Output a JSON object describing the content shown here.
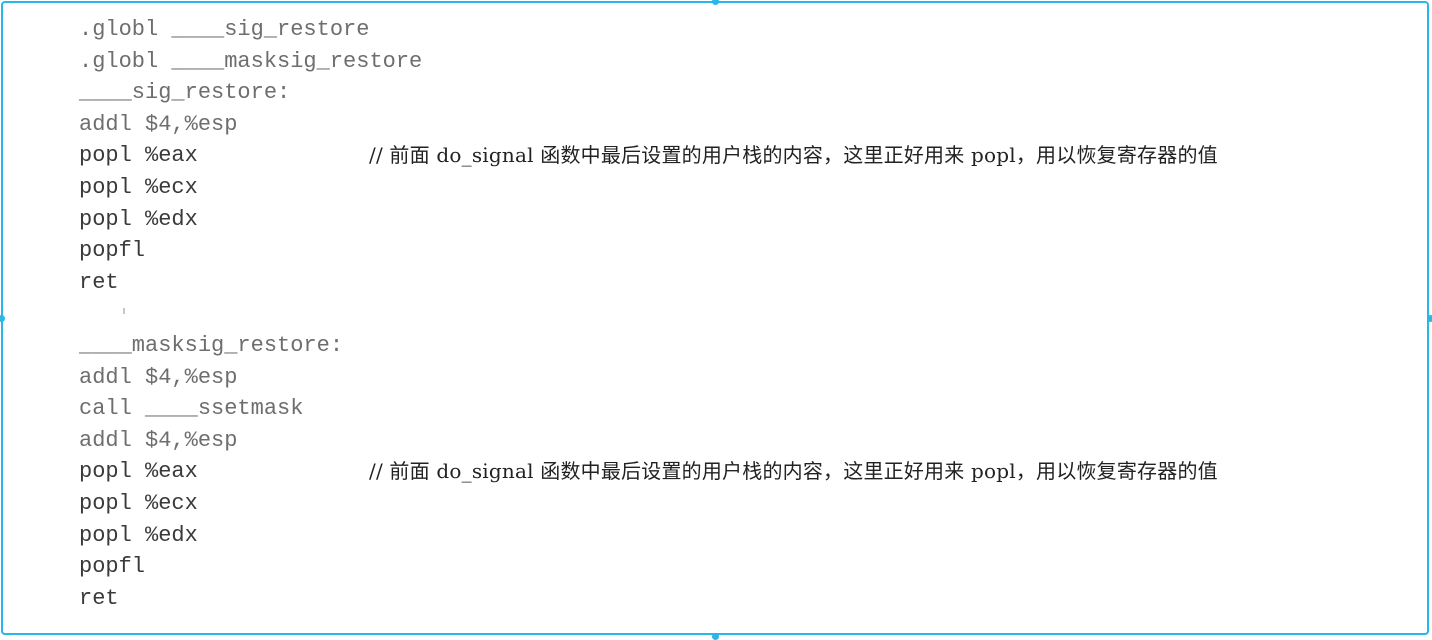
{
  "code_lines": [
    {
      "text": ".globl ____sig_restore",
      "style": "light"
    },
    {
      "text": ".globl ____masksig_restore",
      "style": "light"
    },
    {
      "text": "____sig_restore:",
      "style": "light"
    },
    {
      "text": "addl $4,%esp",
      "style": "light"
    },
    {
      "text": "popl %eax",
      "style": "dark",
      "comment": "// 前面 do_signal 函数中最后设置的用户栈的内容，这里正好用来 popl，用以恢复寄存器的值"
    },
    {
      "text": "popl %ecx",
      "style": "dark"
    },
    {
      "text": "popl %edx",
      "style": "dark"
    },
    {
      "text": "popfl",
      "style": "dark"
    },
    {
      "text": "ret",
      "style": "dark"
    },
    {
      "text": "",
      "style": "gap"
    },
    {
      "text": "____masksig_restore:",
      "style": "light"
    },
    {
      "text": "addl $4,%esp",
      "style": "light"
    },
    {
      "text": "call ____ssetmask",
      "style": "light"
    },
    {
      "text": "addl $4,%esp",
      "style": "light"
    },
    {
      "text": "popl %eax",
      "style": "dark",
      "comment": "// 前面 do_signal 函数中最后设置的用户栈的内容，这里正好用来 popl，用以恢复寄存器的值"
    },
    {
      "text": "popl %ecx",
      "style": "dark"
    },
    {
      "text": "popl %edx",
      "style": "dark"
    },
    {
      "text": "popfl",
      "style": "dark"
    },
    {
      "text": "ret",
      "style": "dark"
    }
  ],
  "accent_color": "#29b6e8"
}
